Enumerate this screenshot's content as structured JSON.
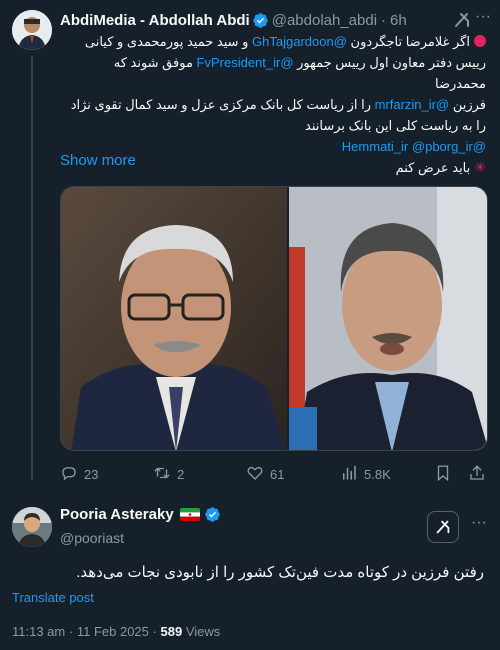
{
  "tweet1": {
    "author_name": "AbdiMedia - Abdollah Abdi",
    "author_handle": "@abdolah_abdi",
    "separator": "·",
    "time": "6h",
    "more_label": "···",
    "body": {
      "line1_pre": "اگر غلامرضا تاجگردون ",
      "mention1": "@GhTajgardoon",
      "line1_post": " و سید حمید پورمحمدی و کیانی",
      "line2_pre": "رییس دفتر معاون اول رییس جمهور ",
      "mention2": "@FvPresident_ir",
      "line2_post": " موفق شوند که محمدرضا",
      "line3_pre": "فرزین ",
      "mention3": "@mrfarzin_ir",
      "line3_post": " را از ریاست کل بانک مرکزی عزل و سید کمال تقوی نژاد",
      "line4": "را به ریاست کلی این بانک برسانند",
      "mention4": "@Hemmati_ir",
      "mention5": "@pborg_ir",
      "line6": "باید عرض کنم"
    },
    "show_more": "Show more",
    "actions": {
      "replies": "23",
      "reposts": "2",
      "likes": "61",
      "views": "5.8K"
    }
  },
  "tweet2": {
    "author_name": "Pooria Asteraky",
    "author_handle": "@pooriast",
    "more_label": "···",
    "body": "رفتن فرزین در کوتاه مدت فین‌تک کشور را از نابودی نجات می‌دهد.",
    "translate": "Translate post",
    "time": "11:13 am",
    "dot": "·",
    "date": "11 Feb 2025",
    "views_count": "589",
    "views_label": "Views"
  },
  "icons": {
    "verified": "verified-badge-icon",
    "grok": "grok-icon",
    "reply": "reply-icon",
    "repost": "repost-icon",
    "like": "like-icon",
    "views": "views-icon",
    "flag": "iran-flag-icon"
  },
  "colors": {
    "background": "#15202b",
    "accent": "#1d9bf0",
    "muted": "#8b98a5",
    "text": "#f7f9f9"
  }
}
